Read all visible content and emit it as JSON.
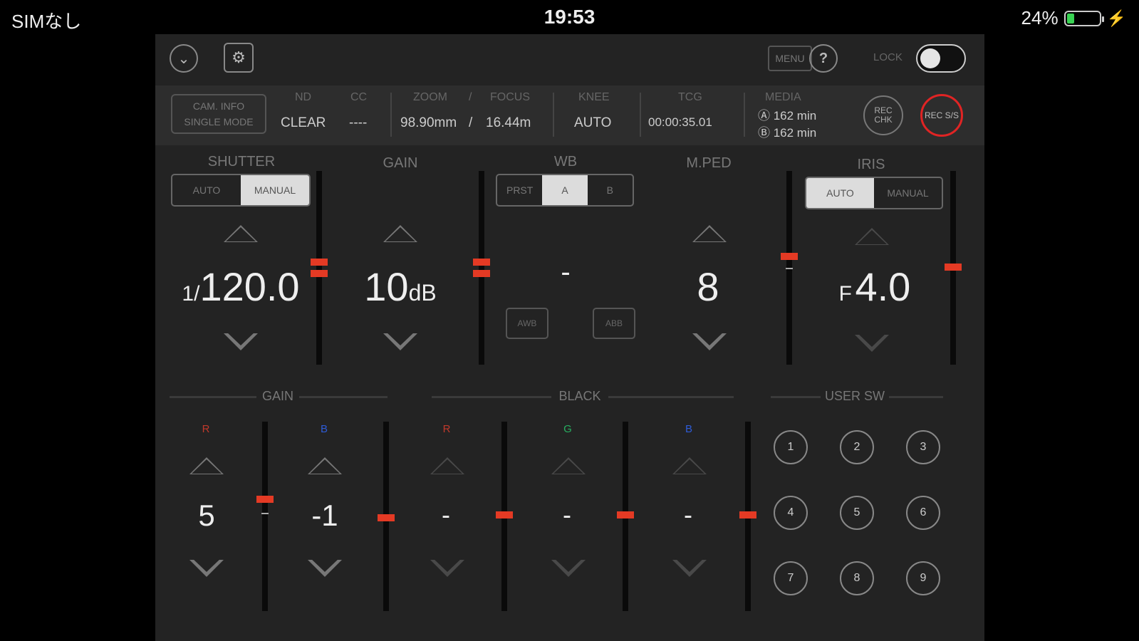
{
  "status_bar": {
    "carrier": "SIMなし",
    "time": "19:53",
    "battery": "24%",
    "battery_level": 0.24
  },
  "toolbar": {
    "menu_label": "MENU",
    "help_label": "?",
    "lock_label": "LOCK",
    "lock_on": false
  },
  "info": {
    "cam_info_line1": "CAM. INFO",
    "cam_info_line2": "SINGLE MODE",
    "nd_label": "ND",
    "nd_value": "CLEAR",
    "cc_label": "CC",
    "cc_value": "----",
    "zoom_label": "ZOOM",
    "slash": "/",
    "focus_label": "FOCUS",
    "zoom_value": "98.90mm",
    "focus_value": "16.44m",
    "knee_label": "KNEE",
    "knee_value": "AUTO",
    "tcg_label": "TCG",
    "tcg_value": "00:00:35.01",
    "media_label": "MEDIA",
    "media_a": "Ⓐ 162 min",
    "media_b": "Ⓑ 162 min",
    "rec_chk_label": "REC CHK",
    "rec_ss_label": "REC S/S"
  },
  "shutter": {
    "label": "SHUTTER",
    "auto": "AUTO",
    "manual": "MANUAL",
    "selected": "manual",
    "prefix": "1/",
    "value": "120.0"
  },
  "gain": {
    "label": "GAIN",
    "value": "10",
    "unit": "dB"
  },
  "wb": {
    "label": "WB",
    "modes": [
      "PRST",
      "A",
      "B"
    ],
    "selected": "A",
    "value": "-",
    "awb": "AWB",
    "abb": "ABB"
  },
  "mped": {
    "label": "M.PED",
    "value": "8"
  },
  "iris": {
    "label": "IRIS",
    "auto": "AUTO",
    "manual": "MANUAL",
    "selected": "auto",
    "prefix": "F",
    "value": "4.0"
  },
  "bottom": {
    "gain_label": "GAIN",
    "black_label": "BLACK",
    "usersw_label": "USER SW",
    "gain_r": {
      "label": "R",
      "value": "5"
    },
    "gain_b": {
      "label": "B",
      "value": "-1"
    },
    "black_r": {
      "label": "R",
      "value": "-"
    },
    "black_g": {
      "label": "G",
      "value": "-"
    },
    "black_b": {
      "label": "B",
      "value": "-"
    },
    "user_buttons": [
      "1",
      "2",
      "3",
      "4",
      "5",
      "6",
      "7",
      "8",
      "9"
    ]
  },
  "colors": {
    "accent_red": "#e43a24",
    "channel_r": "#c0392b",
    "channel_g": "#27ae60",
    "channel_b": "#2e5bd6"
  }
}
